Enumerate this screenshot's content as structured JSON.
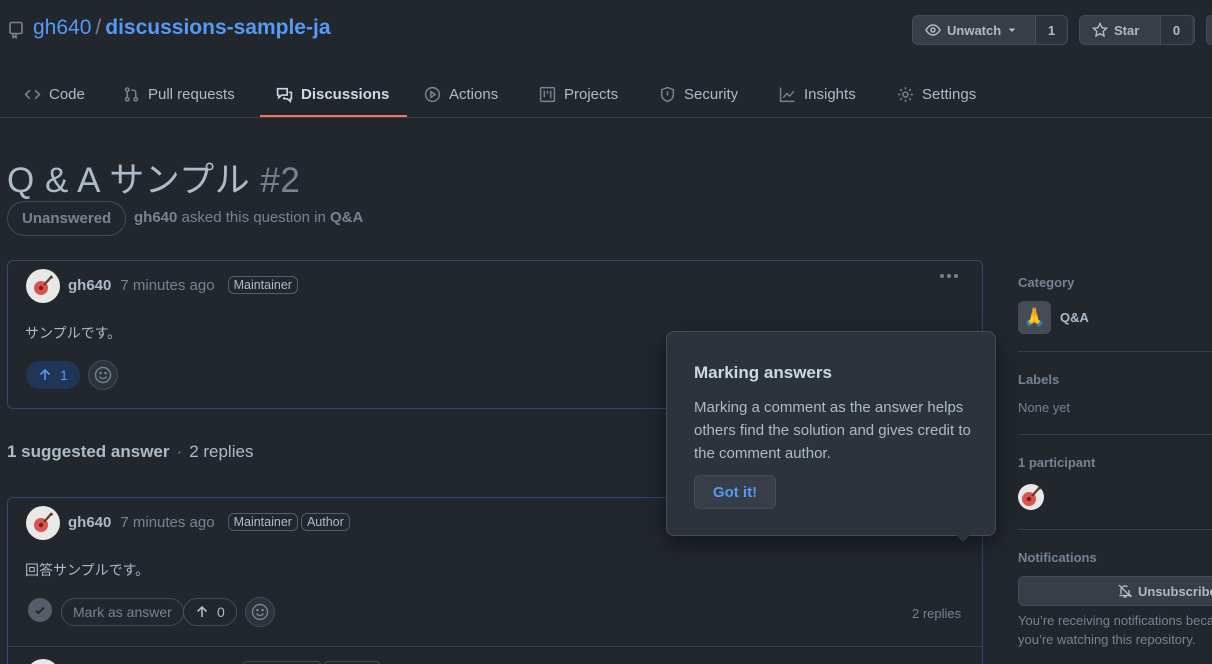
{
  "repo": {
    "owner": "gh640",
    "separator": "/",
    "name": "discussions-sample-ja"
  },
  "header_buttons": {
    "unwatch_label": "Unwatch",
    "unwatch_count": "1",
    "star_label": "Star",
    "star_count": "0"
  },
  "tabs": [
    {
      "label": "Code",
      "icon": "code-icon"
    },
    {
      "label": "Pull requests",
      "icon": "git-pull-request-icon"
    },
    {
      "label": "Discussions",
      "icon": "comment-discussion-icon",
      "active": true
    },
    {
      "label": "Actions",
      "icon": "play-icon"
    },
    {
      "label": "Projects",
      "icon": "project-icon"
    },
    {
      "label": "Security",
      "icon": "shield-icon"
    },
    {
      "label": "Insights",
      "icon": "graph-icon"
    },
    {
      "label": "Settings",
      "icon": "gear-icon"
    }
  ],
  "discussion": {
    "title": "Q & A サンプル",
    "number": "#2",
    "status": "Unanswered",
    "author": "gh640",
    "asked_text": "asked this question in",
    "category": "Q&A"
  },
  "question": {
    "author": "gh640",
    "time": "7 minutes ago",
    "labels": [
      "Maintainer"
    ],
    "body": "サンプルです。",
    "upvotes": "1"
  },
  "answers_summary": {
    "suggested": "1 suggested answer",
    "replies": "2 replies"
  },
  "answer": {
    "author": "gh640",
    "time": "7 minutes ago",
    "labels": [
      "Maintainer",
      "Author"
    ],
    "body": "回答サンプルです。",
    "mark_label": "Mark as answer",
    "upvotes": "0",
    "replies": "2 replies"
  },
  "popover": {
    "title": "Marking answers",
    "body": "Marking a comment as the answer helps others find the solution and gives credit to the comment author.",
    "button": "Got it!"
  },
  "sidebar": {
    "category_heading": "Category",
    "category_icon": "🙏",
    "category_name": "Q&A",
    "labels_heading": "Labels",
    "labels_value": "None yet",
    "participants_heading": "1 participant",
    "notifications_heading": "Notifications",
    "unsubscribe_label": "Unsubscribe",
    "notification_note": "You’re receiving notifications because you’re watching this repository."
  },
  "colors": {
    "accent": "#539bf5",
    "tab_underline": "#ec775c",
    "background": "#22272e"
  }
}
